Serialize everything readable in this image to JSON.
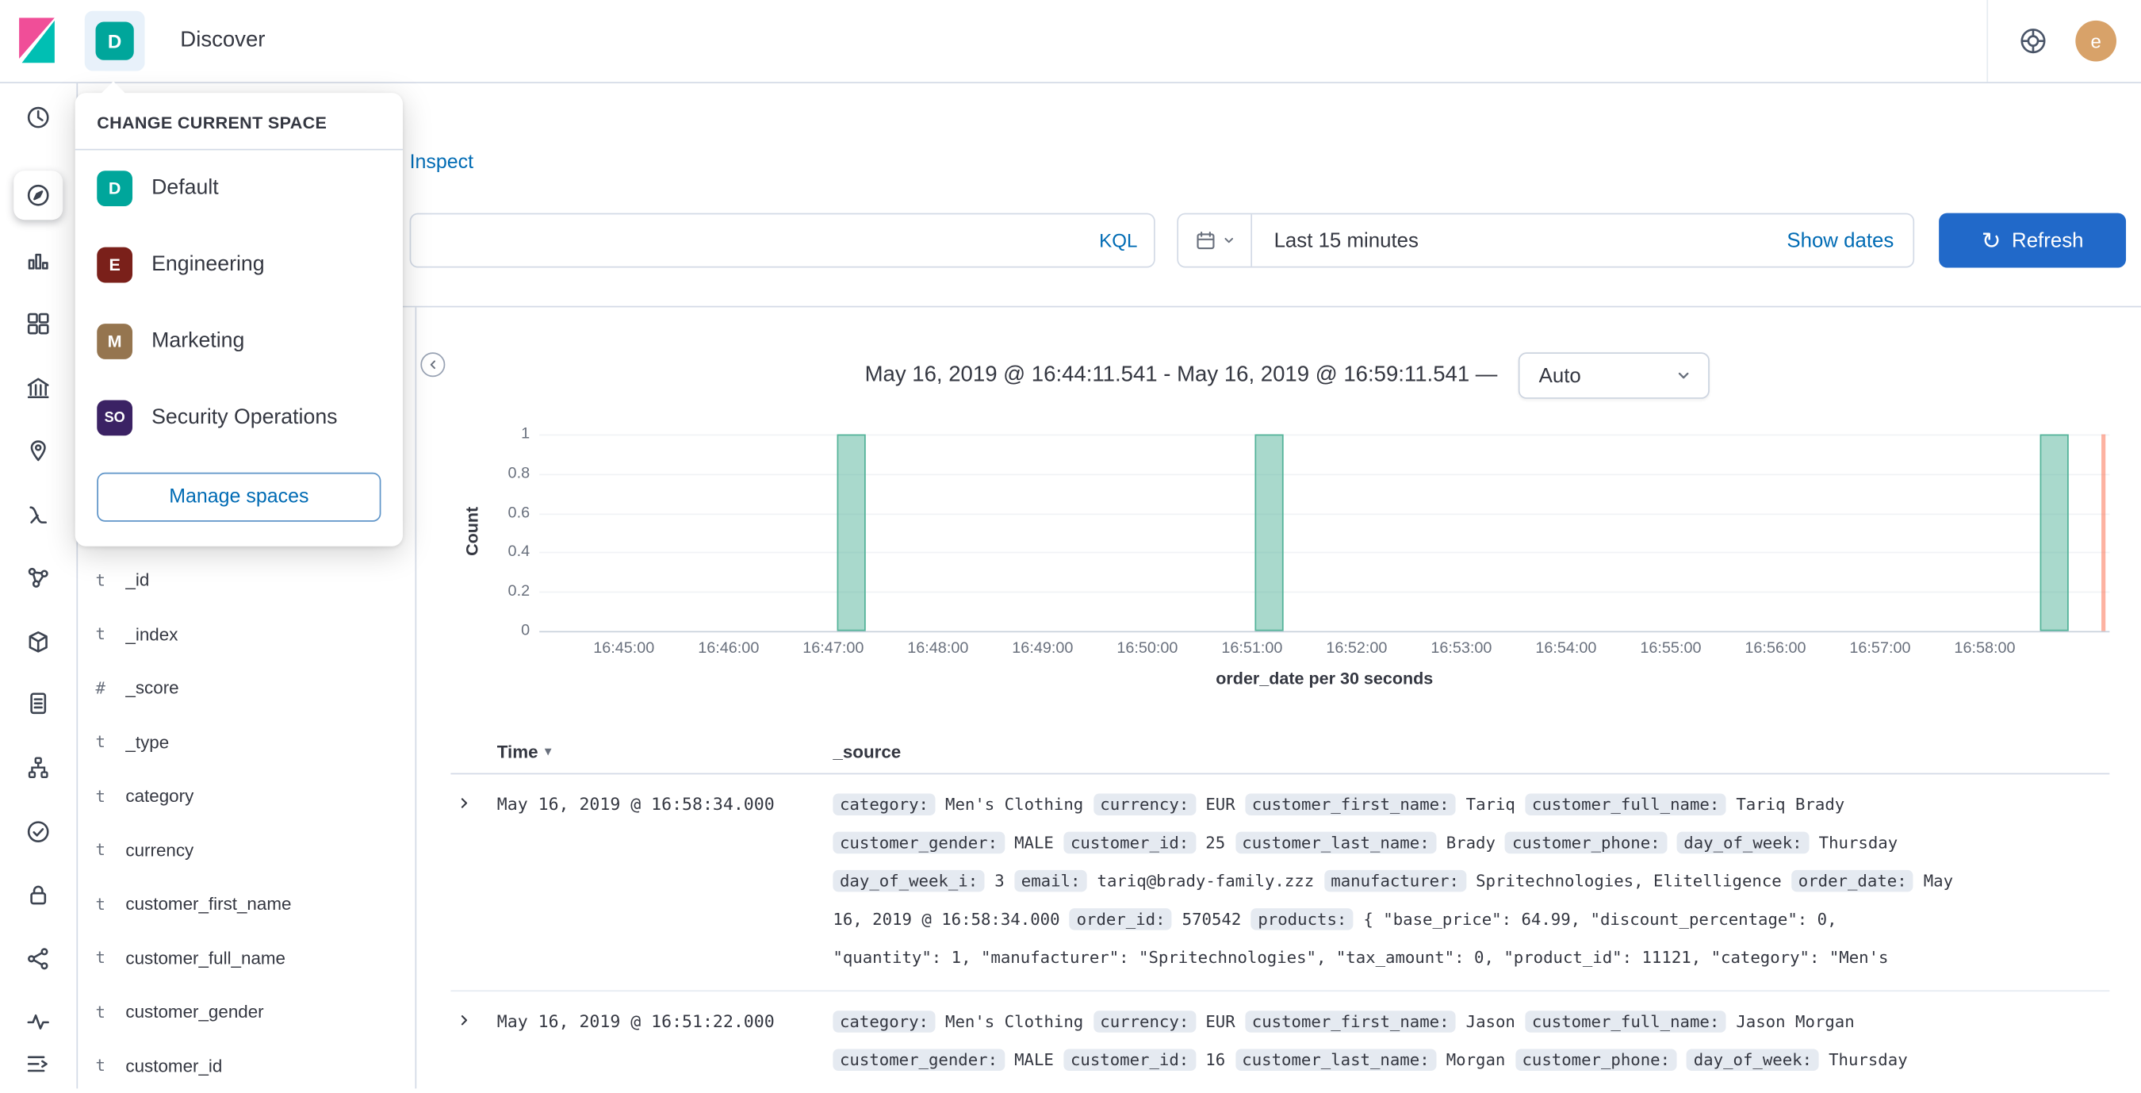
{
  "topbar": {
    "space_initial": "D",
    "breadcrumb": "Discover",
    "avatar_initial": "e"
  },
  "nav": {
    "icons": [
      "recent",
      "discover",
      "visualize",
      "dashboard",
      "canvas",
      "maps",
      "machine-learning",
      "graph",
      "apm",
      "logs",
      "infrastructure",
      "uptime",
      "security",
      "dev-tools",
      "monitoring",
      "collapse-menu"
    ],
    "active": "discover"
  },
  "spaces_popover": {
    "title": "CHANGE CURRENT SPACE",
    "spaces": [
      {
        "initials": "D",
        "label": "Default",
        "color": "#00A69B"
      },
      {
        "initials": "E",
        "label": "Engineering",
        "color": "#7A201A"
      },
      {
        "initials": "M",
        "label": "Marketing",
        "color": "#95754F"
      },
      {
        "initials": "SO",
        "label": "Security Operations",
        "color": "#3B2264"
      }
    ],
    "manage_button": "Manage spaces"
  },
  "toolbar": {
    "inspect_label": "Inspect",
    "kql_label": "KQL",
    "time_range": "Last 15 minutes",
    "show_dates_label": "Show dates",
    "refresh_label": "Refresh"
  },
  "chart_header": {
    "range_label": "May 16, 2019 @ 16:44:11.541 - May 16, 2019 @ 16:59:11.541 —",
    "interval_value": "Auto"
  },
  "chart_data": {
    "type": "bar",
    "title": "May 16, 2019 @ 16:44:11.541 - May 16, 2019 @ 16:59:11.541",
    "ylabel": "Count",
    "xlabel": "order_date per 30 seconds",
    "ylim": [
      0,
      1
    ],
    "yticks": [
      0,
      0.2,
      0.4,
      0.6,
      0.8,
      1
    ],
    "x_start": "16:44:11.541",
    "x_end": "16:59:11.541",
    "xticks": [
      "16:45:00",
      "16:46:00",
      "16:47:00",
      "16:48:00",
      "16:49:00",
      "16:50:00",
      "16:51:00",
      "16:52:00",
      "16:53:00",
      "16:54:00",
      "16:55:00",
      "16:56:00",
      "16:57:00",
      "16:58:00"
    ],
    "bucket_seconds": 30,
    "categories": [
      "16:47:00",
      "16:51:00",
      "16:58:30"
    ],
    "values": [
      1,
      1,
      1
    ],
    "time_marker": "16:59:08",
    "grid": false,
    "legend": false
  },
  "field_list": {
    "items": [
      {
        "type": "t",
        "name": "_id"
      },
      {
        "type": "t",
        "name": "_index"
      },
      {
        "type": "#",
        "name": "_score"
      },
      {
        "type": "t",
        "name": "_type"
      },
      {
        "type": "t",
        "name": "category"
      },
      {
        "type": "t",
        "name": "currency"
      },
      {
        "type": "t",
        "name": "customer_first_name"
      },
      {
        "type": "t",
        "name": "customer_full_name"
      },
      {
        "type": "t",
        "name": "customer_gender"
      },
      {
        "type": "t",
        "name": "customer_id"
      }
    ]
  },
  "table": {
    "headers": [
      "Time",
      "_source"
    ],
    "rows": [
      {
        "time": "May 16, 2019 @ 16:58:34.000",
        "source_lines": [
          [
            {
              "k": "category:"
            },
            {
              "t": "Men's Clothing"
            },
            {
              "k": "currency:"
            },
            {
              "t": "EUR"
            },
            {
              "k": "customer_first_name:"
            },
            {
              "t": "Tariq"
            },
            {
              "k": "customer_full_name:"
            },
            {
              "t": "Tariq Brady"
            }
          ],
          [
            {
              "k": "customer_gender:"
            },
            {
              "t": "MALE"
            },
            {
              "k": "customer_id:"
            },
            {
              "t": "25"
            },
            {
              "k": "customer_last_name:"
            },
            {
              "t": "Brady"
            },
            {
              "k": "customer_phone:"
            },
            {
              "k": "day_of_week:"
            },
            {
              "t": "Thursday"
            }
          ],
          [
            {
              "k": "day_of_week_i:"
            },
            {
              "t": "3"
            },
            {
              "k": "email:"
            },
            {
              "t": "tariq@brady-family.zzz"
            },
            {
              "k": "manufacturer:"
            },
            {
              "t": "Spritechnologies, Elitelligence"
            },
            {
              "k": "order_date:"
            },
            {
              "t": "May"
            }
          ],
          [
            {
              "t": "16, 2019 @ 16:58:34.000"
            },
            {
              "k": "order_id:"
            },
            {
              "t": "570542"
            },
            {
              "k": "products:"
            },
            {
              "t": "{ \"base_price\": 64.99, \"discount_percentage\": 0,"
            }
          ],
          [
            {
              "t": "\"quantity\": 1, \"manufacturer\": \"Spritechnologies\", \"tax_amount\": 0, \"product_id\": 11121, \"category\": \"Men's"
            }
          ]
        ]
      },
      {
        "time": "May 16, 2019 @ 16:51:22.000",
        "source_lines": [
          [
            {
              "k": "category:"
            },
            {
              "t": "Men's Clothing"
            },
            {
              "k": "currency:"
            },
            {
              "t": "EUR"
            },
            {
              "k": "customer_first_name:"
            },
            {
              "t": "Jason"
            },
            {
              "k": "customer_full_name:"
            },
            {
              "t": "Jason Morgan"
            }
          ],
          [
            {
              "k": "customer_gender:"
            },
            {
              "t": "MALE"
            },
            {
              "k": "customer_id:"
            },
            {
              "t": "16"
            },
            {
              "k": "customer_last_name:"
            },
            {
              "t": "Morgan"
            },
            {
              "k": "customer_phone:"
            },
            {
              "k": "day_of_week:"
            },
            {
              "t": "Thursday"
            }
          ]
        ]
      }
    ]
  },
  "colors": {
    "primary_link": "#006BB4",
    "refresh_button": "#2169C9",
    "bar_fill": "#54B399",
    "time_marker": "#FB7E62",
    "chip_bg": "#E5EAF1",
    "avatar_bg": "#D8A269",
    "space_default": "#00A69B",
    "kibana_pink": "#F04E98",
    "kibana_teal": "#00BFB3"
  }
}
